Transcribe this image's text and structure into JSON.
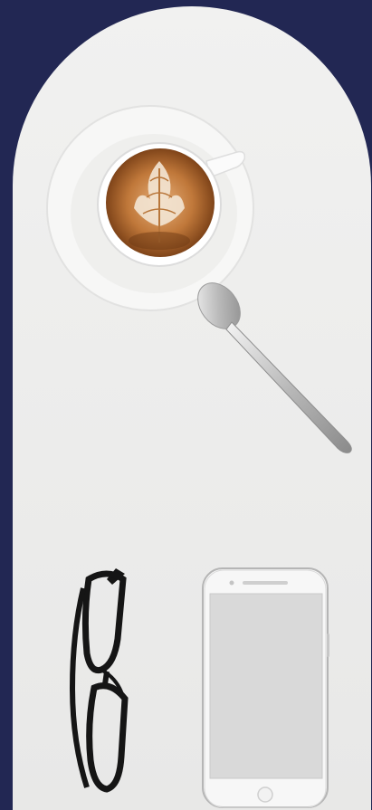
{
  "colors": {
    "background": "#222753",
    "card": "#ededec",
    "saucer": "#f7f7f6",
    "crema": "#b8763a",
    "phone_screen": "#d9d9d9",
    "glasses_frame": "#151515"
  },
  "scene": {
    "items": [
      "coffee-cup-icon",
      "spoon-icon",
      "glasses-icon",
      "smartphone-icon"
    ]
  }
}
